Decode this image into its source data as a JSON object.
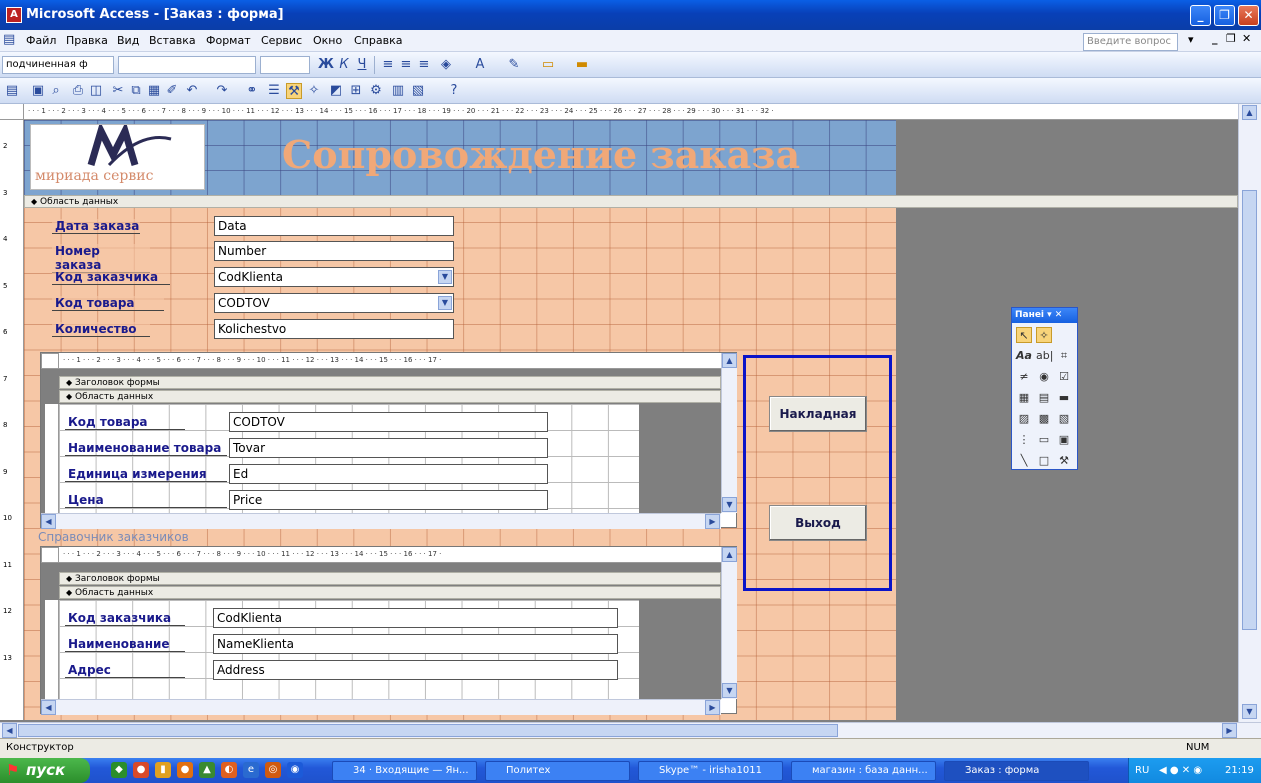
{
  "window": {
    "title": "Microsoft Access - [Заказ : форма]",
    "help_placeholder": "Введите вопрос"
  },
  "menu": [
    "Файл",
    "Правка",
    "Вид",
    "Вставка",
    "Формат",
    "Сервис",
    "Окно",
    "Справка"
  ],
  "toolbar": {
    "object_combo": "подчиненная ф",
    "font_combo": "",
    "size_combo": ""
  },
  "ruler": {
    "main": "· · · 1 · · · 2 · · · 3 · · · 4 · · · 5 · · · 6 · · · 7 · · · 8 · · · 9 · · · 10 · · · 11 · · · 12 · · · 13 · · · 14 · · · 15 · · · 16 · · · 17 · · · 18 · · · 19 · · · 20 · · · 21 · · · 22 · · · 23 · · · 24 · · · 25 · · · 26 · · · 27 · · · 28 · · · 29 · · · 30 · · · 31 · · · 32 ·",
    "sub": "· · · 1 · · · 2 · · · 3 · · · 4 · · · 5 · · · 6 · · · 7 · · · 8 · · · 9 · · · 10 · · · 11 · · · 12 · · · 13 · · · 14 · · · 15 · · · 16 · · · 17 ·"
  },
  "header": {
    "logo_text": "мириада сервис",
    "title": "Сопровождение заказа"
  },
  "section_data": "Область данных",
  "section_header": "Заголовок формы",
  "main_fields": [
    {
      "label": "Дата заказа",
      "value": "Data",
      "combo": false
    },
    {
      "label": "Номер заказа",
      "value": "Number",
      "combo": false
    },
    {
      "label": "Код заказчика",
      "value": "CodKlienta",
      "combo": true
    },
    {
      "label": "Код товара",
      "value": "CODTOV",
      "combo": true
    },
    {
      "label": "Количество",
      "value": "Kolichestvo",
      "combo": false
    }
  ],
  "subform1_fields": [
    {
      "label": "Код товара",
      "value": "CODTOV"
    },
    {
      "label": "Наименование товара",
      "value": "Tovar"
    },
    {
      "label": "Единица измерения",
      "value": "Ed"
    },
    {
      "label": "Цена",
      "value": "Price"
    }
  ],
  "subform2_caption": "Справочник заказчиков",
  "subform2_fields": [
    {
      "label": "Код заказчика",
      "value": "CodKlienta"
    },
    {
      "label": "Наименование",
      "value": "NameKlienta"
    },
    {
      "label": "Адрес",
      "value": "Address"
    }
  ],
  "buttons": {
    "invoice": "Накладная",
    "exit": "Выход"
  },
  "toolbox": {
    "title": "Панеі"
  },
  "status": {
    "mode": "Конструктор",
    "num": "NUM"
  },
  "taskbar": {
    "start": "пуск",
    "tasks": [
      "34 · Входящие — Ян...",
      "Политех",
      "Skype™ - irisha1011",
      "магазин : база данн...",
      "Заказ : форма"
    ],
    "lang": "RU",
    "clock": "21:19"
  },
  "colors": {
    "form_bg": "#f6c7a6",
    "header_bg": "#7da4cf",
    "label_text": "#1a1a8c",
    "title_text": "#f0a878",
    "selection": "#0a14c8"
  }
}
